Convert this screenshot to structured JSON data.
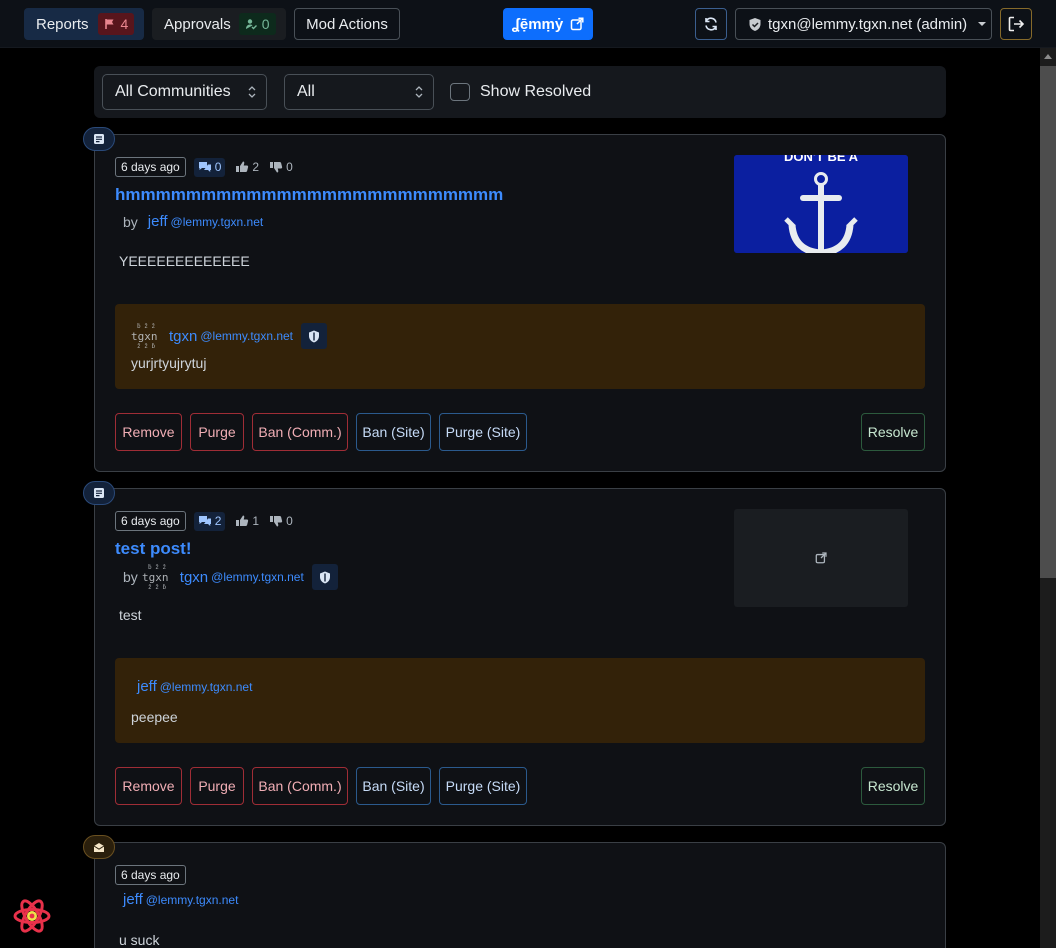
{
  "topbar": {
    "reports_label": "Reports",
    "reports_count": "4",
    "approvals_label": "Approvals",
    "approvals_count": "0",
    "mod_actions_label": "Mod Actions",
    "instance_button_label": "ʆẹ̄mṃẏ",
    "user_label": "tgxn@lemmy.tgxn.net (admin)"
  },
  "filters": {
    "community_select": "All Communities",
    "type_select": "All",
    "show_resolved_label": "Show Resolved",
    "show_resolved_checked": false
  },
  "reports": [
    {
      "kind": "post",
      "time_ago": "6 days ago",
      "comments": "0",
      "upvotes": "2",
      "downvotes": "0",
      "title": "hmmmmmmmmmmmmmmmmmmmmmmmmm",
      "by": "by",
      "author": "jeff",
      "author_instance": "@lemmy.tgxn.net",
      "body": "YEEEEEEEEEEEEE",
      "thumbnail_text": "DON'T BE A",
      "report_author": "tgxn",
      "report_author_avatar_text": "tgxn",
      "report_author_instance": "@lemmy.tgxn.net",
      "report_reason": "yurjrtyujrytuj",
      "actions": [
        "Remove",
        "Purge",
        "Ban (Comm.)",
        "Ban (Site)",
        "Purge (Site)"
      ],
      "resolve": "Resolve"
    },
    {
      "kind": "post",
      "time_ago": "6 days ago",
      "comments": "2",
      "upvotes": "1",
      "downvotes": "0",
      "title": "test post!",
      "by": "by",
      "author": "tgxn",
      "author_avatar_text": "tgxn",
      "author_instance": "@lemmy.tgxn.net",
      "body": "test",
      "report_author": "jeff",
      "report_author_instance": "@lemmy.tgxn.net",
      "report_reason": "peepee",
      "actions": [
        "Remove",
        "Purge",
        "Ban (Comm.)",
        "Ban (Site)",
        "Purge (Site)"
      ],
      "resolve": "Resolve"
    },
    {
      "kind": "message",
      "time_ago": "6 days ago",
      "author": "jeff",
      "author_instance": "@lemmy.tgxn.net",
      "body": "u suck"
    }
  ],
  "colors": {
    "link": "#3d8bfd",
    "danger": "#9f2d36",
    "report_bg": "#332209",
    "primary": "#0d6efd"
  }
}
